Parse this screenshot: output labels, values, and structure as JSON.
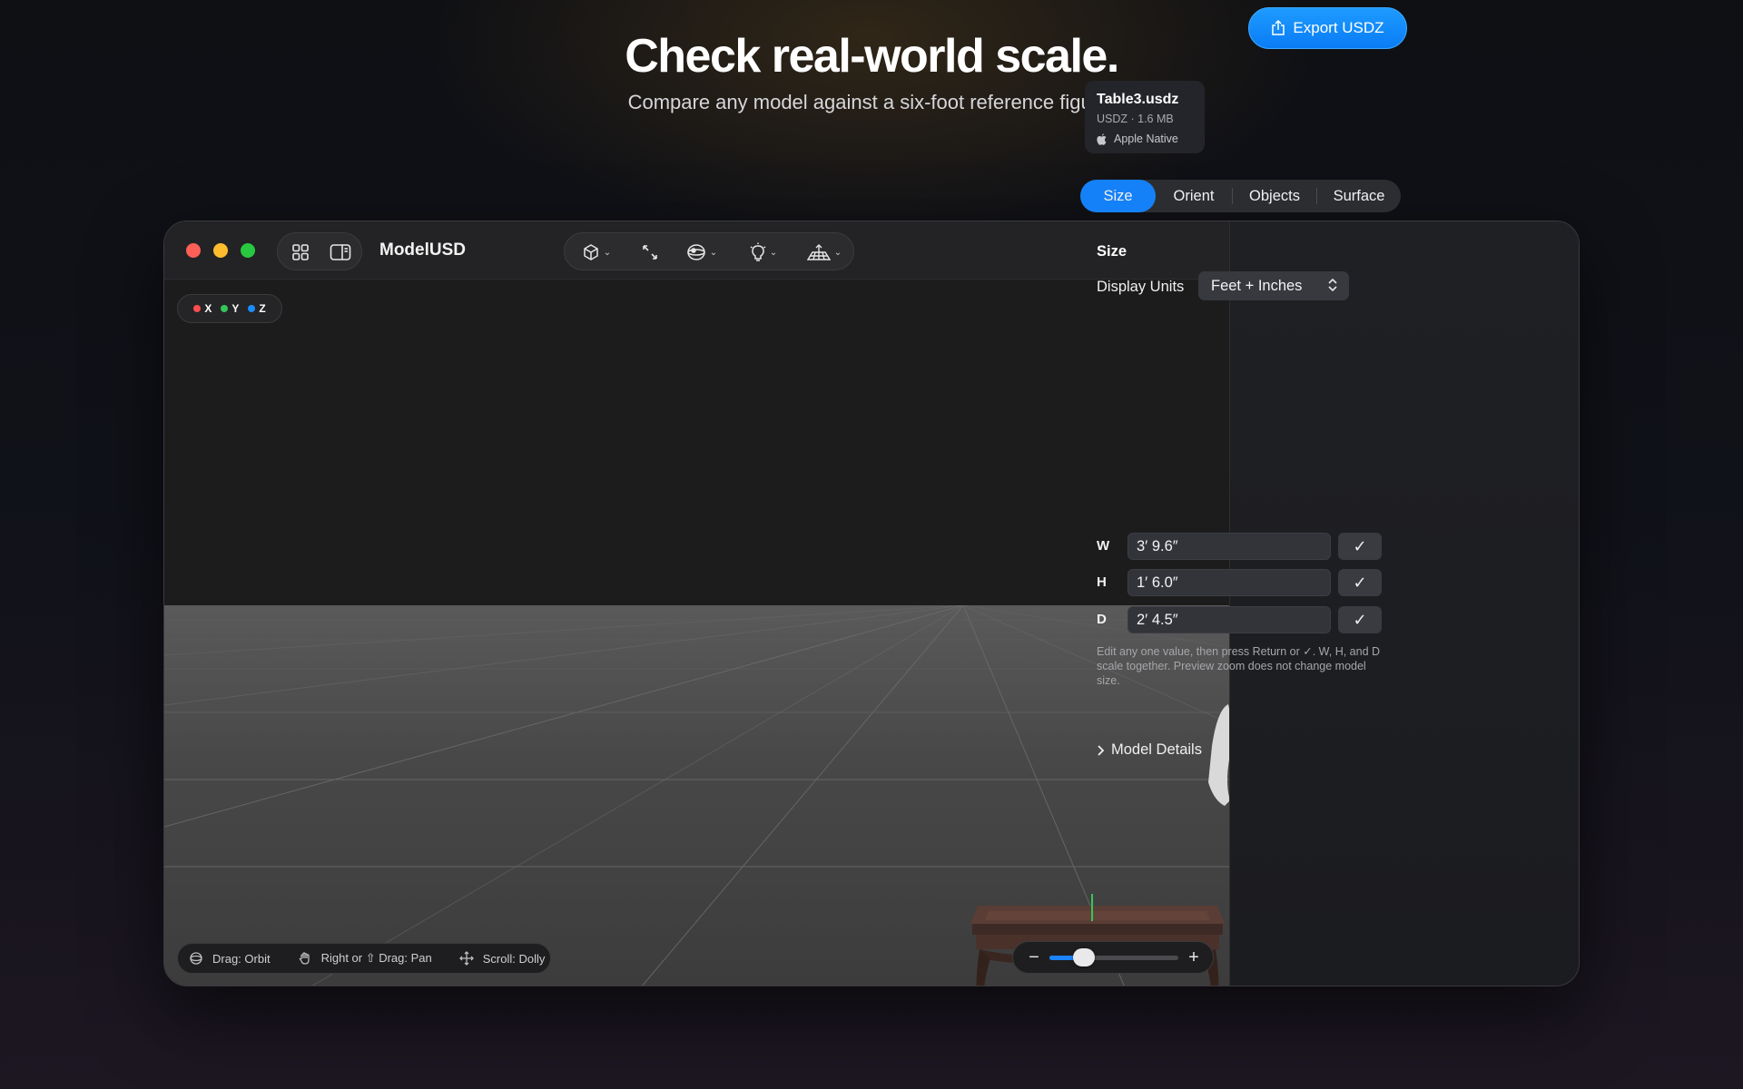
{
  "hero": {
    "title": "Check real-world scale.",
    "subtitle": "Compare any model against a six-foot reference figure."
  },
  "app": {
    "title": "ModelUSD"
  },
  "toolbar": {
    "left_icons": [
      "grid-icon",
      "sidebar-icon"
    ],
    "tools": [
      "cube-icon",
      "expand-icon",
      "environment-icon",
      "lightbulb-icon",
      "ground-grid-icon"
    ]
  },
  "axes": {
    "items": [
      {
        "label": "X",
        "color": "#ff4d4f"
      },
      {
        "label": "Y",
        "color": "#34c759"
      },
      {
        "label": "Z",
        "color": "#1a8cff"
      }
    ]
  },
  "hints": {
    "orbit": "Drag: Orbit",
    "pan": "Right or ⇧ Drag: Pan",
    "dolly": "Scroll: Dolly"
  },
  "zoom": {
    "minus": "−",
    "plus": "+",
    "level": 0.27
  },
  "export": {
    "label": "Export USDZ"
  },
  "file": {
    "name": "Table3.usdz",
    "meta": "USDZ · 1.6 MB",
    "native": "Apple Native"
  },
  "tabs": [
    {
      "label": "Size",
      "active": true
    },
    {
      "label": "Orient",
      "active": false
    },
    {
      "label": "Objects",
      "active": false
    },
    {
      "label": "Surface",
      "active": false
    }
  ],
  "size": {
    "section_title": "Size",
    "units_label": "Display Units",
    "units_value": "Feet + Inches",
    "dims": [
      {
        "key": "W",
        "value": "3′ 9.6″"
      },
      {
        "key": "H",
        "value": "1′ 6.0″"
      },
      {
        "key": "D",
        "value": "2′ 4.5″"
      }
    ],
    "help": "Edit any one value, then press Return or ✓. W, H, and D scale together. Preview zoom does not change model size."
  },
  "details": {
    "label": "Model Details"
  },
  "colors": {
    "accent": "#1581f8"
  }
}
